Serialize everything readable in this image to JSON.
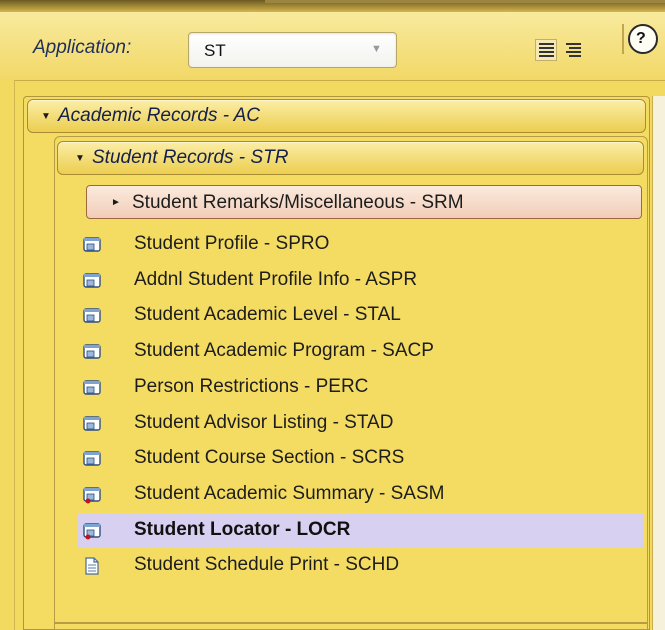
{
  "toolbar": {
    "application_label": "Application:",
    "application_value": "ST"
  },
  "tree": {
    "level1": {
      "label": "Academic Records - AC",
      "expanded": true
    },
    "level2": {
      "label": "Student Records - STR",
      "expanded": true
    },
    "level3": {
      "label": "Student Remarks/Miscellaneous - SRM",
      "expanded": false
    },
    "items": [
      {
        "label": "Student Profile - SPRO",
        "icon": "form-icon"
      },
      {
        "label": "Addnl Student Profile Info - ASPR",
        "icon": "form-icon"
      },
      {
        "label": "Student Academic Level - STAL",
        "icon": "form-icon"
      },
      {
        "label": "Student Academic Program - SACP",
        "icon": "form-icon"
      },
      {
        "label": "Person Restrictions - PERC",
        "icon": "form-icon"
      },
      {
        "label": "Student Advisor Listing - STAD",
        "icon": "form-icon"
      },
      {
        "label": "Student Course Section - SCRS",
        "icon": "form-icon"
      },
      {
        "label": "Student Academic Summary - SASM",
        "icon": "form-alert-icon"
      },
      {
        "label": "Student Locator - LOCR",
        "icon": "form-alert-icon",
        "selected": true
      },
      {
        "label": "Student Schedule Print - SCHD",
        "icon": "document-icon"
      }
    ]
  },
  "colors": {
    "panel": "#f2d95f",
    "selected_row": "#d8d0f0",
    "header_text": "#14204a"
  }
}
